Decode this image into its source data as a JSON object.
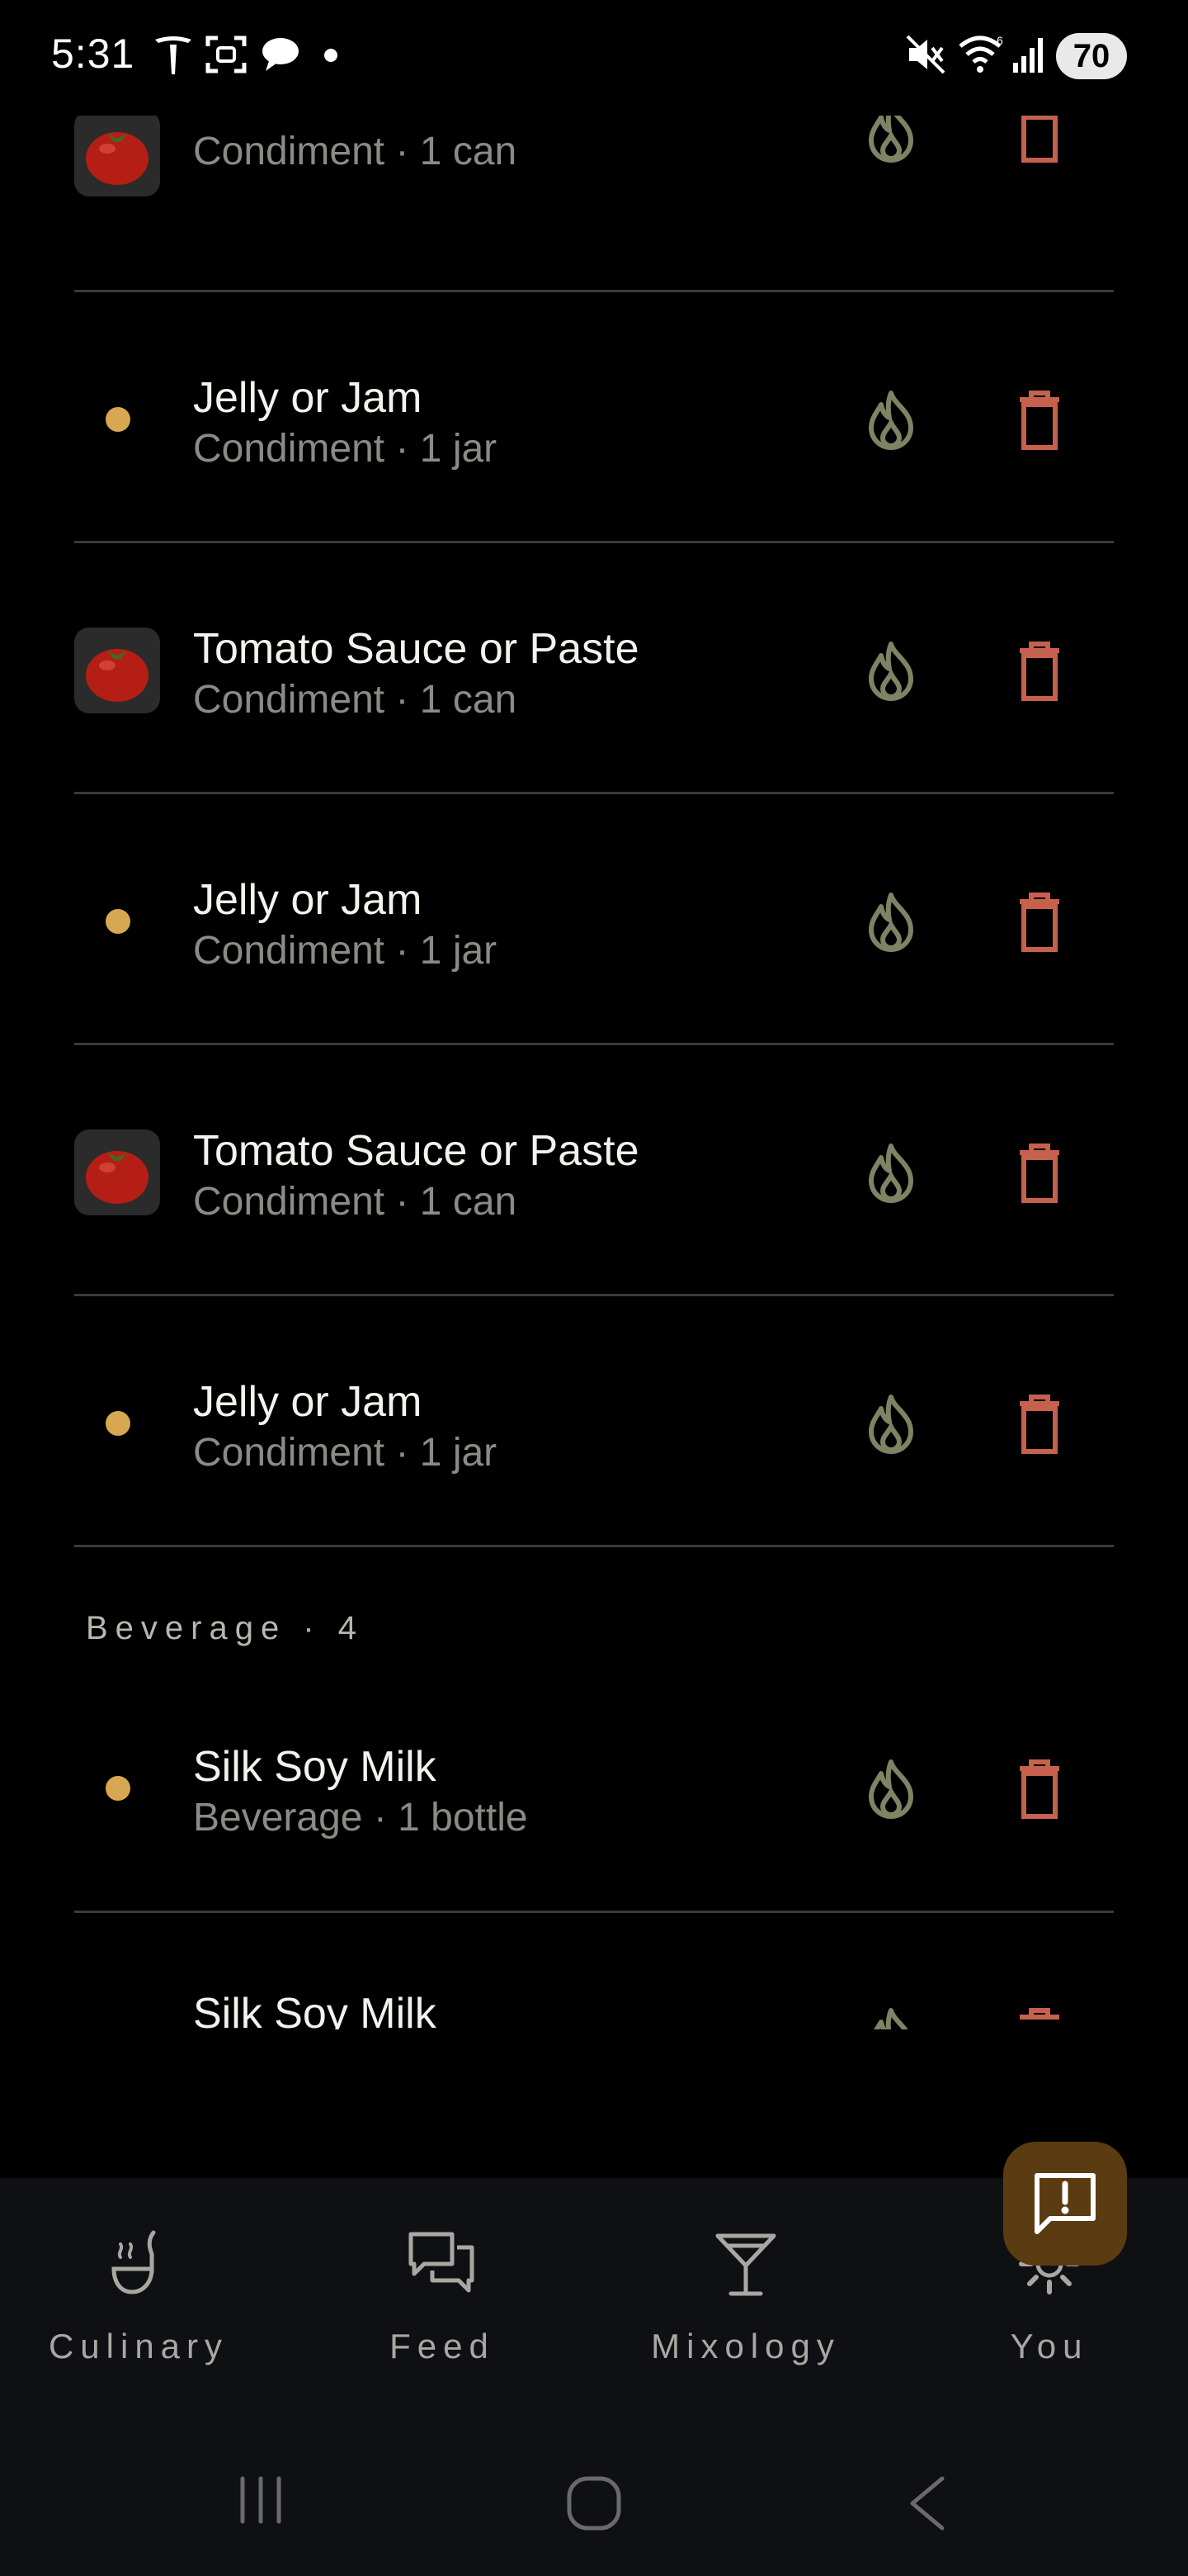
{
  "status_bar": {
    "time": "5:31",
    "battery": "70"
  },
  "list": {
    "rows": [
      {
        "kind": "thumb",
        "title": "",
        "subtitle": "Condiment · 1 can"
      },
      {
        "kind": "dot",
        "title": "Jelly or Jam",
        "subtitle": "Condiment · 1 jar"
      },
      {
        "kind": "thumb",
        "title": "Tomato Sauce or Paste",
        "subtitle": "Condiment · 1 can"
      },
      {
        "kind": "dot",
        "title": "Jelly or Jam",
        "subtitle": "Condiment · 1 jar"
      },
      {
        "kind": "thumb",
        "title": "Tomato Sauce or Paste",
        "subtitle": "Condiment · 1 can"
      },
      {
        "kind": "dot",
        "title": "Jelly or Jam",
        "subtitle": "Condiment · 1 jar"
      }
    ],
    "section": {
      "label": "Beverage · 4",
      "rows": [
        {
          "kind": "dot",
          "title": "Silk Soy Milk",
          "subtitle": "Beverage · 1 bottle"
        },
        {
          "kind": "dot",
          "title": "Silk Soy Milk",
          "subtitle": ""
        }
      ]
    }
  },
  "bottom_nav": {
    "items": [
      {
        "label": "Culinary",
        "icon": "ladle-icon"
      },
      {
        "label": "Feed",
        "icon": "chat-bubbles-icon"
      },
      {
        "label": "Mixology",
        "icon": "cocktail-glass-icon"
      },
      {
        "label": "You",
        "icon": "gear-icon"
      }
    ]
  },
  "fab": {
    "icon": "feedback-icon"
  },
  "colors": {
    "background": "#000000",
    "dot": "#d7a851",
    "flame": "#7c8464",
    "trash": "#c5614c",
    "nav_bg": "#0f1014",
    "fab_bg": "#5b3b12"
  }
}
